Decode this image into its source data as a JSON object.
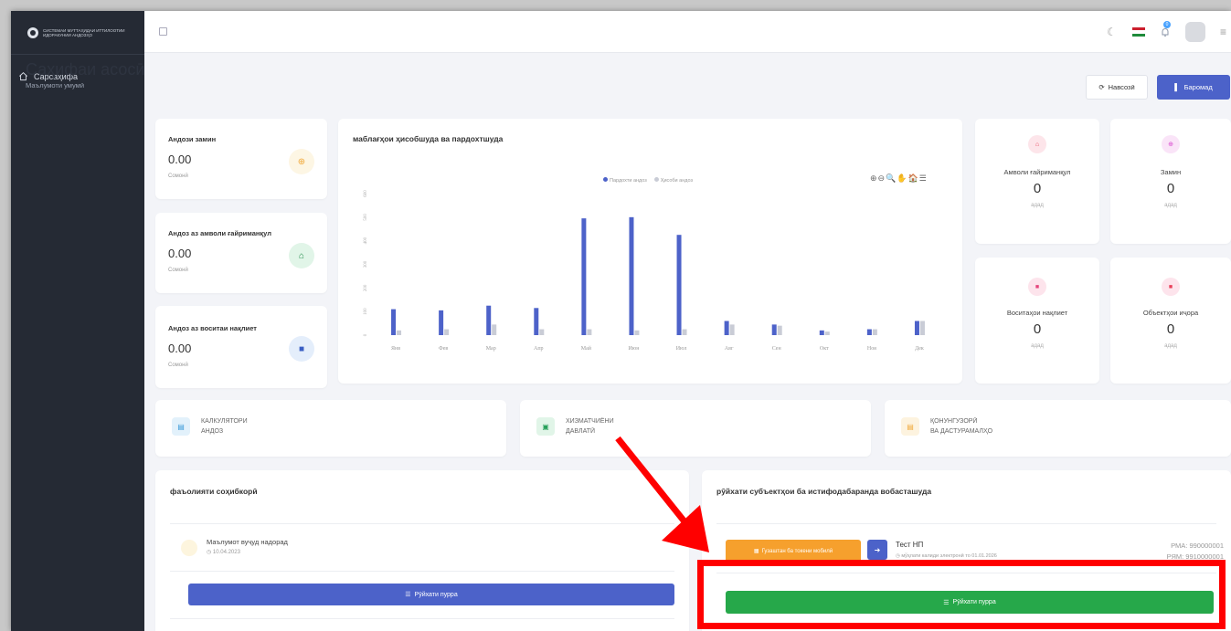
{
  "sidebar": {
    "logo_text": "Системаи муттаҳидаи иттилоотии идоракунии андозҳо",
    "items": [
      {
        "label": "Сарсаҳифа",
        "icon": "home-icon"
      }
    ]
  },
  "topbar": {
    "notifications_count": "0"
  },
  "header": {
    "title": "Саҳифаи асосӣ",
    "subtitle": "Маълумоти умумӣ",
    "refresh_label": "Навсозӣ",
    "export_label": "Баромад"
  },
  "stats": [
    {
      "label": "Андози замин",
      "value": "0.00",
      "unit": "Сомонӣ",
      "icon": "globe-icon",
      "color": "#f1a93b",
      "bg": "#fdf6e4"
    },
    {
      "label": "Андоз аз амволи ғайриманқул",
      "value": "0.00",
      "unit": "Сомонӣ",
      "icon": "home-icon",
      "color": "#1e8a48",
      "bg": "#e1f5e8"
    },
    {
      "label": "Андоз аз воситаи нақлиет",
      "value": "0.00",
      "unit": "Сомонӣ",
      "icon": "truck-icon",
      "color": "#3a5fc4",
      "bg": "#e4eefb"
    }
  ],
  "chart_data": {
    "type": "bar",
    "title": "маблағҳои ҳисобшуда ва пардохтшуда",
    "categories": [
      "Янв",
      "Фев",
      "Мар",
      "Апр",
      "Май",
      "Июн",
      "Июл",
      "Авг",
      "Сен",
      "Окт",
      "Ноя",
      "Дек"
    ],
    "series": [
      {
        "name": "Пардохти андоз",
        "color": "#4d62c9",
        "values": [
          110,
          105,
          125,
          115,
          495,
          500,
          425,
          60,
          45,
          20,
          25,
          60
        ]
      },
      {
        "name": "Ҳисоби андоз",
        "color": "#c9ccd6",
        "values": [
          20,
          25,
          45,
          25,
          25,
          20,
          25,
          45,
          40,
          15,
          25,
          60
        ]
      }
    ],
    "ylim": [
      0,
      600
    ],
    "yticks": [
      "0",
      "100",
      "200",
      "300",
      "400",
      "500",
      "600"
    ],
    "tools": "⊕⊖🔍✋🏠☰"
  },
  "counts": [
    {
      "label": "Амволи ғайриманқул",
      "value": "0",
      "unit": "адад",
      "color": "#e8415a",
      "bg": "#fde5ea"
    },
    {
      "label": "Замин",
      "value": "0",
      "unit": "адад",
      "color": "#d94ccf",
      "bg": "#fae4f8"
    },
    {
      "label": "Воситаҳои нақлиет",
      "value": "0",
      "unit": "адад",
      "color": "#e5457c",
      "bg": "#fde4ec"
    },
    {
      "label": "Объектҳои иҷора",
      "value": "0",
      "unit": "адад",
      "color": "#e8415a",
      "bg": "#fde4ec"
    }
  ],
  "quick_links": [
    {
      "line1": "Калкулятори",
      "line2": "андоз",
      "color": "#3a9ad9",
      "bg": "#e2f1fb"
    },
    {
      "line1": "Хизматчиёни",
      "line2": "давлатӣ",
      "color": "#27a05a",
      "bg": "#e1f5e8"
    },
    {
      "line1": "Қонунгузорӣ",
      "line2": "ва дастурамалҳо",
      "color": "#f1a93b",
      "bg": "#fdf3df"
    }
  ],
  "activity": {
    "title": "фаъолияти соҳибкорӣ",
    "empty_text": "Маълумот вуҷуд надорад",
    "date": "10.04.2023",
    "full_list_label": "Рӯйхати пурра"
  },
  "subjects": {
    "title": "рӯйхати субъектҳои ба истифодабаранда вобасташуда",
    "mobile_token_label": "Гузаштан ба токени мобилӣ",
    "name": "Тест НП",
    "note": "мўҳлати калиди электронӣ то 01.01.2026",
    "rma": "РМА: 990000001",
    "rmm": "РЯМ: 9910000001",
    "full_list_label": "Рӯйхати пурра"
  },
  "colors": {
    "primary": "#4c62c9",
    "success": "#26a84a",
    "warning": "#f6a02d",
    "highlight": "#ff0000"
  }
}
